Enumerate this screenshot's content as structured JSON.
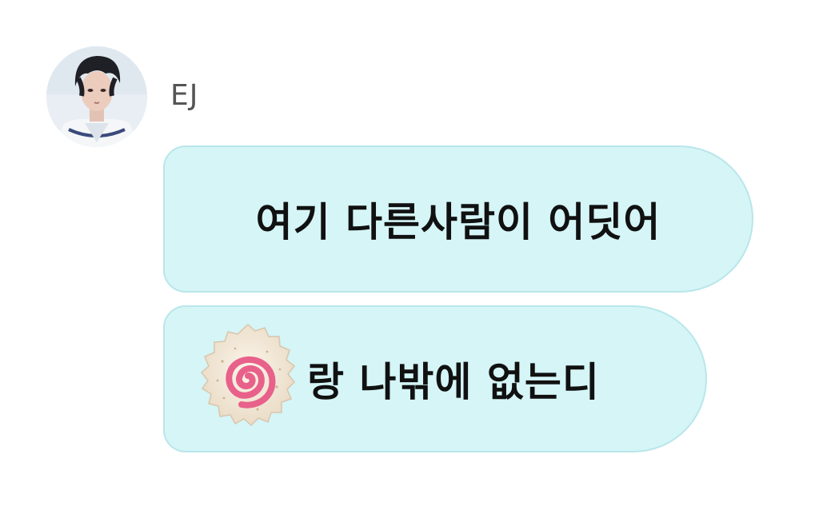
{
  "chat": {
    "sender": {
      "name": "EJ",
      "avatar": "user-avatar-photo"
    },
    "messages": [
      {
        "text": "여기 다른사람이 어딧어"
      },
      {
        "emoji": "narutomaki-emoji",
        "text": "랑 나밖에 없는디"
      }
    ]
  },
  "colors": {
    "bubble_fill": "#d5f5f7",
    "bubble_border": "#b9e6ea",
    "name_color": "#555555",
    "text_color": "#111111"
  }
}
